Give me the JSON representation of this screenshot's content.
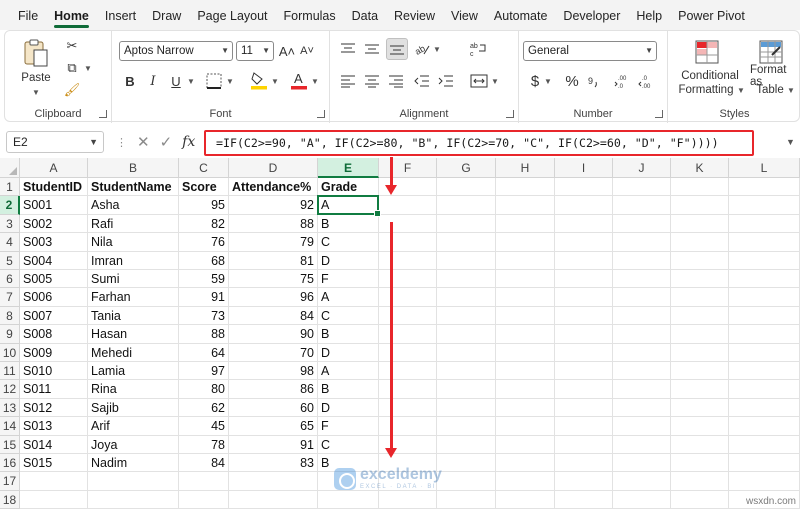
{
  "menu": {
    "tabs": [
      "File",
      "Home",
      "Insert",
      "Draw",
      "Page Layout",
      "Formulas",
      "Data",
      "Review",
      "View",
      "Automate",
      "Developer",
      "Help",
      "Power Pivot"
    ],
    "active": "Home"
  },
  "ribbon": {
    "clipboard": {
      "label": "Clipboard",
      "paste": "Paste"
    },
    "font": {
      "label": "Font",
      "font_name": "Aptos Narrow",
      "font_size": "11",
      "bold": "B",
      "italic": "I",
      "underline": "U",
      "grow": "A˄",
      "shrink": "A˅"
    },
    "alignment": {
      "label": "Alignment"
    },
    "number": {
      "label": "Number",
      "format": "General",
      "currency": "$",
      "percent": "%"
    },
    "styles": {
      "label": "Styles",
      "conditional_line1": "Conditional",
      "conditional_line2": "Formatting",
      "format_as_line1": "Format as",
      "format_as_line2": "Table"
    }
  },
  "formula_bar": {
    "name_box": "E2",
    "formula": "=IF(C2>=90, \"A\", IF(C2>=80, \"B\", IF(C2>=70, \"C\", IF(C2>=60, \"D\", \"F\"))))"
  },
  "sheet": {
    "columns": [
      "A",
      "B",
      "C",
      "D",
      "E",
      "F",
      "G",
      "H",
      "I",
      "J",
      "K",
      "L"
    ],
    "rows": [
      "1",
      "2",
      "3",
      "4",
      "5",
      "6",
      "7",
      "8",
      "9",
      "10",
      "11",
      "12",
      "13",
      "14",
      "15",
      "16",
      "17",
      "18"
    ],
    "selected_cell": "E2",
    "headers": [
      "StudentID",
      "StudentName",
      "Score",
      "Attendance%",
      "Grade"
    ],
    "data": [
      [
        "S001",
        "Asha",
        "95",
        "92",
        "A"
      ],
      [
        "S002",
        "Rafi",
        "82",
        "88",
        "B"
      ],
      [
        "S003",
        "Nila",
        "76",
        "79",
        "C"
      ],
      [
        "S004",
        "Imran",
        "68",
        "81",
        "D"
      ],
      [
        "S005",
        "Sumi",
        "59",
        "75",
        "F"
      ],
      [
        "S006",
        "Farhan",
        "91",
        "96",
        "A"
      ],
      [
        "S007",
        "Tania",
        "73",
        "84",
        "C"
      ],
      [
        "S008",
        "Hasan",
        "88",
        "90",
        "B"
      ],
      [
        "S009",
        "Mehedi",
        "64",
        "70",
        "D"
      ],
      [
        "S010",
        "Lamia",
        "97",
        "98",
        "A"
      ],
      [
        "S011",
        "Rina",
        "80",
        "86",
        "B"
      ],
      [
        "S012",
        "Sajib",
        "62",
        "60",
        "D"
      ],
      [
        "S013",
        "Arif",
        "45",
        "65",
        "F"
      ],
      [
        "S014",
        "Joya",
        "78",
        "91",
        "C"
      ],
      [
        "S015",
        "Nadim",
        "84",
        "83",
        "B"
      ]
    ]
  },
  "watermark": {
    "title": "exceldemy",
    "subtitle": "EXCEL · DATA · BI"
  },
  "site_mark": "wsxdn.com",
  "colors": {
    "accent": "#107c41",
    "highlight": "#e8262b"
  }
}
